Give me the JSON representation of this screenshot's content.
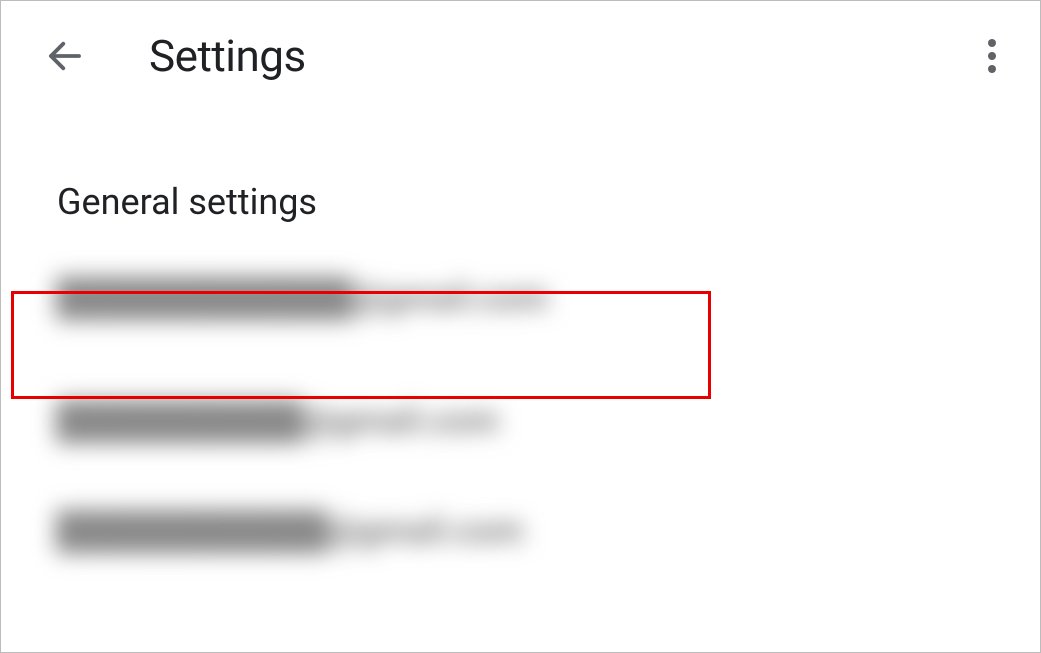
{
  "header": {
    "title": "Settings"
  },
  "section": {
    "general_label": "General settings"
  },
  "accounts": [
    {
      "placeholder": "████████████@gmail.com"
    },
    {
      "placeholder": "██████████@gmail.com"
    },
    {
      "placeholder": "███████████@gmail.com"
    }
  ],
  "annotations": {
    "highlighted_index": 0
  }
}
